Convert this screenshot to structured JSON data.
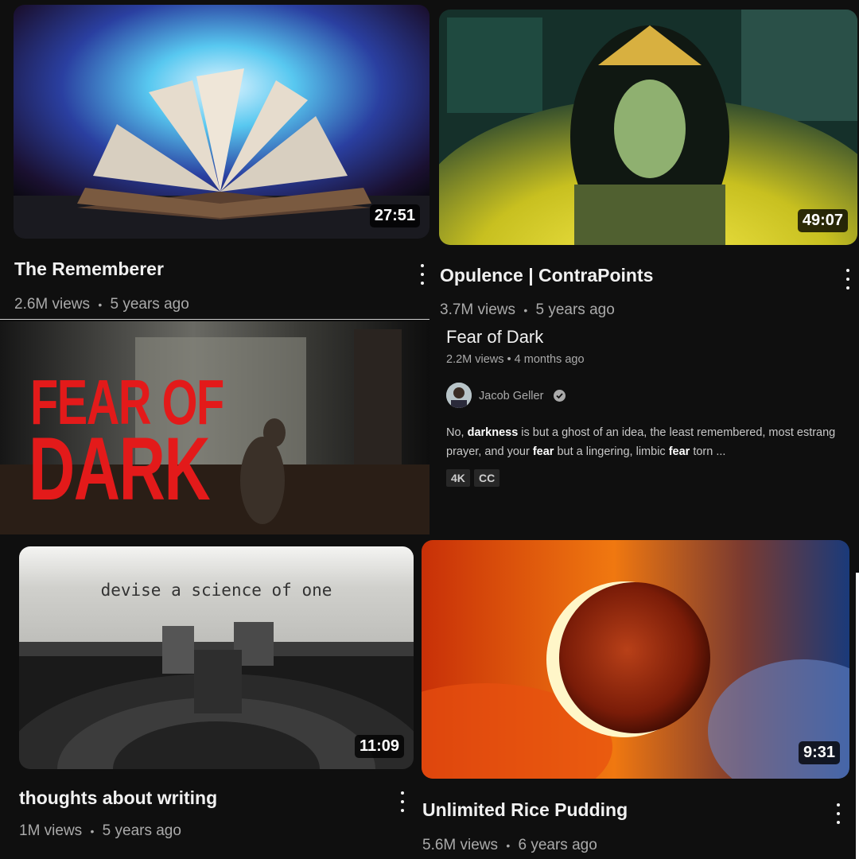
{
  "videos": [
    {
      "title": "The Rememberer",
      "views": "2.6M views",
      "age": "5 years ago",
      "duration": "27:51"
    },
    {
      "title": "Opulence | ContraPoints",
      "views": "3.7M views",
      "age": "5 years ago",
      "duration": "49:07"
    },
    {
      "title": "thoughts about writing",
      "views": "1M views",
      "age": "5 years ago",
      "duration": "11:09",
      "thumb_text": "devise a science of one"
    },
    {
      "title": "Unlimited Rice Pudding",
      "views": "5.6M views",
      "age": "6 years ago",
      "duration": "9:31"
    }
  ],
  "search_result": {
    "title": "Fear of Dark",
    "meta": "2.2M views • 4 months ago",
    "channel": "Jacob Geller",
    "thumb_line1": "FEAR OF",
    "thumb_line2": "DARK",
    "description": [
      {
        "text": "No, ",
        "bold": false
      },
      {
        "text": "darkness",
        "bold": true
      },
      {
        "text": " is but a ghost of an idea, the least remembered, most estrang",
        "bold": false
      }
    ],
    "description_line2": [
      {
        "text": "prayer, and your ",
        "bold": false
      },
      {
        "text": "fear",
        "bold": true
      },
      {
        "text": " but a lingering, limbic ",
        "bold": false
      },
      {
        "text": "fear",
        "bold": true
      },
      {
        "text": " torn ...",
        "bold": false
      }
    ],
    "badges": [
      "4K",
      "CC"
    ]
  },
  "separator": "•"
}
